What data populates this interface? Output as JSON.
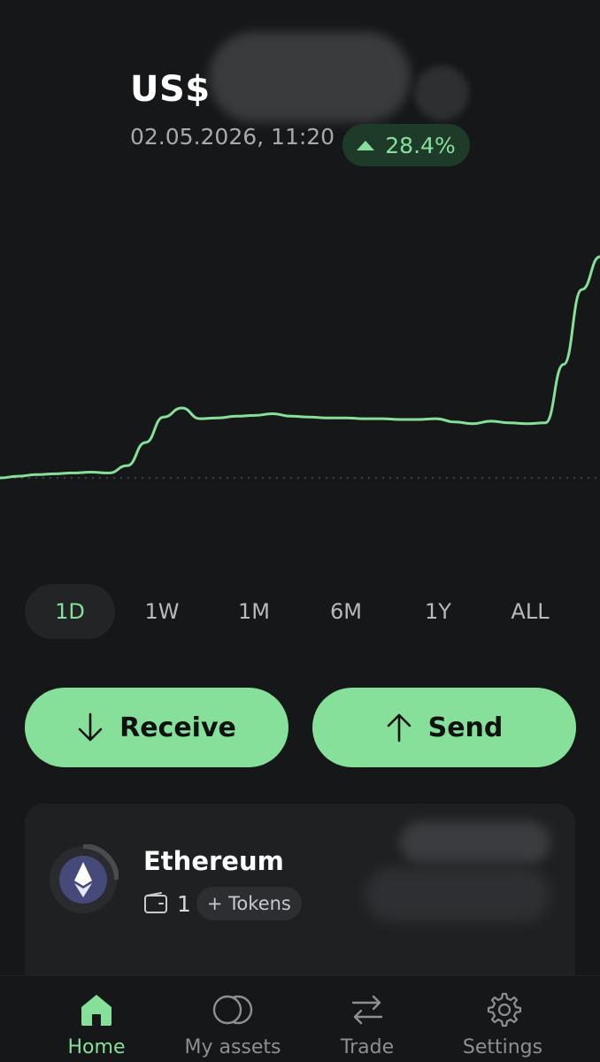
{
  "header": {
    "currency": "US$",
    "timestamp": "02.05.2026, 11:20",
    "change": "28.4%"
  },
  "chart_data": {
    "type": "line",
    "x": [
      0,
      1,
      2,
      3,
      4,
      5,
      6,
      7,
      8,
      9,
      10,
      11,
      12,
      13,
      14,
      15,
      16,
      17,
      18,
      19,
      20,
      21,
      22,
      23,
      24,
      25,
      26,
      27,
      28,
      29,
      30,
      31,
      32,
      33
    ],
    "series": [
      {
        "values": [
          100,
          100.2,
          100.4,
          100.5,
          100.6,
          100.7,
          100.6,
          101.5,
          104.3,
          107.4,
          108.5,
          107.2,
          107.3,
          107.5,
          107.6,
          107.8,
          107.5,
          107.4,
          107.3,
          107.3,
          107.2,
          107.2,
          107.1,
          107.1,
          107.2,
          106.8,
          106.6,
          106.9,
          106.7,
          106.6,
          106.7,
          113.8,
          122.9,
          126.9
        ]
      }
    ],
    "baseline": 100,
    "accent": "#86e09a",
    "grid": false,
    "legend": false
  },
  "ranges": [
    {
      "label": "1D",
      "active": true
    },
    {
      "label": "1W",
      "active": false
    },
    {
      "label": "1M",
      "active": false
    },
    {
      "label": "6M",
      "active": false
    },
    {
      "label": "1Y",
      "active": false
    },
    {
      "label": "ALL",
      "active": false
    }
  ],
  "actions": {
    "receive_label": "Receive",
    "send_label": "Send"
  },
  "asset": {
    "name": "Ethereum",
    "wallet_count": "1",
    "tokens_label": "+ Tokens",
    "icon": "ethereum-icon"
  },
  "nav": [
    {
      "label": "Home",
      "icon": "home-icon",
      "active": true
    },
    {
      "label": "My assets",
      "icon": "assets-icon",
      "active": false
    },
    {
      "label": "Trade",
      "icon": "trade-icon",
      "active": false
    },
    {
      "label": "Settings",
      "icon": "gear-icon",
      "active": false
    }
  ],
  "colors": {
    "background": "#161718",
    "accent": "#86e09a",
    "badge_bg": "#1e3a28"
  }
}
